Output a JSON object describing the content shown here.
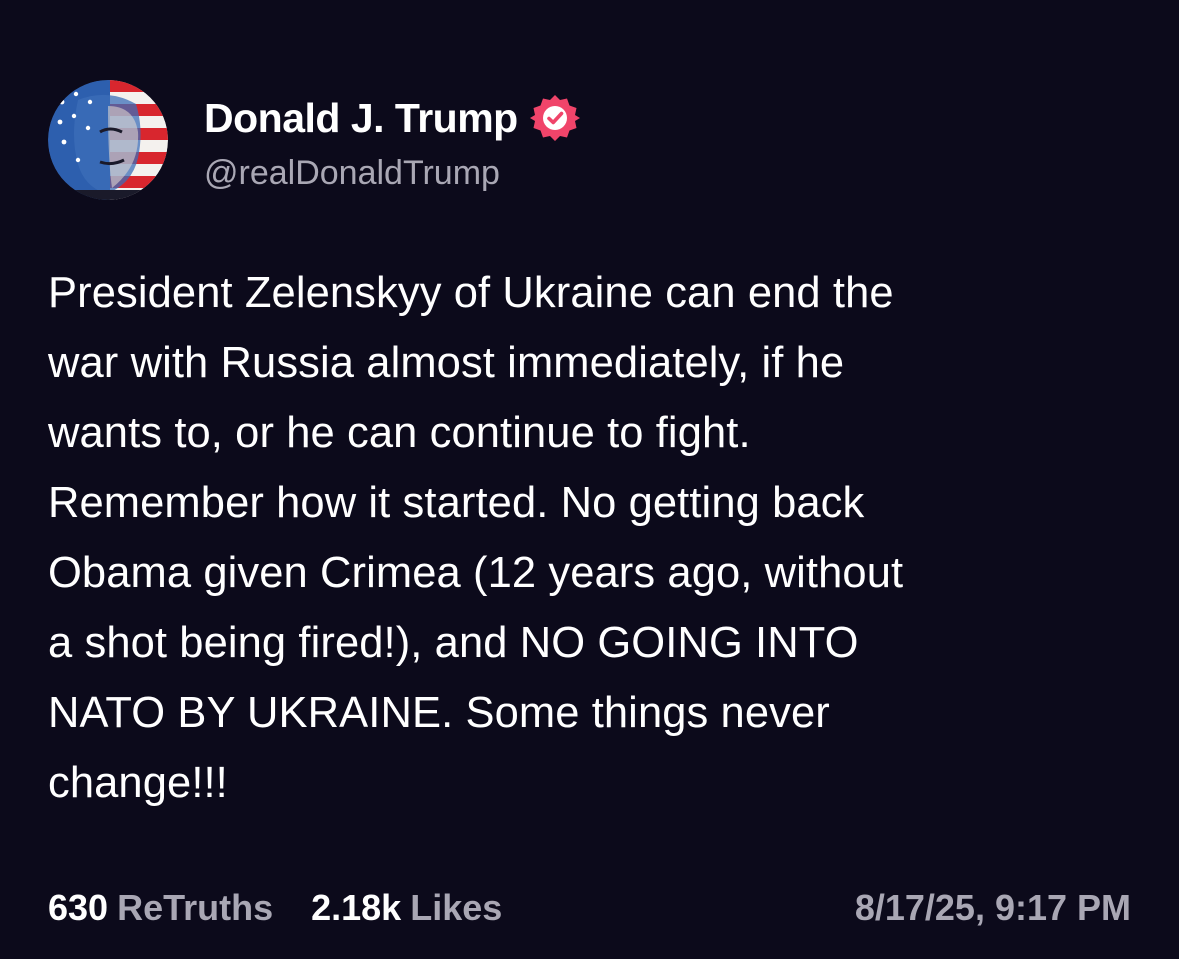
{
  "post": {
    "author": {
      "display_name": "Donald J. Trump",
      "handle": "@realDonaldTrump",
      "verified_icon": "verified-badge-icon",
      "verified_color": "#f0446a"
    },
    "body_lines": [
      "President Zelenskyy of Ukraine can end the",
      "war with Russia almost immediately, if he",
      "wants to, or he can continue to fight.",
      "Remember how it started. No getting back",
      "Obama given Crimea (12 years ago, without",
      "a shot being fired!), and NO GOING INTO",
      "NATO BY UKRAINE. Some things never",
      "change!!!"
    ],
    "stats": {
      "retruths_count": "630",
      "retruths_label": "ReTruths",
      "likes_count": "2.18k",
      "likes_label": "Likes"
    },
    "timestamp": "8/17/25, 9:17 PM"
  },
  "colors": {
    "background": "#0c0a1b",
    "primary_text": "#ffffff",
    "secondary_text": "#a9a7b4"
  }
}
